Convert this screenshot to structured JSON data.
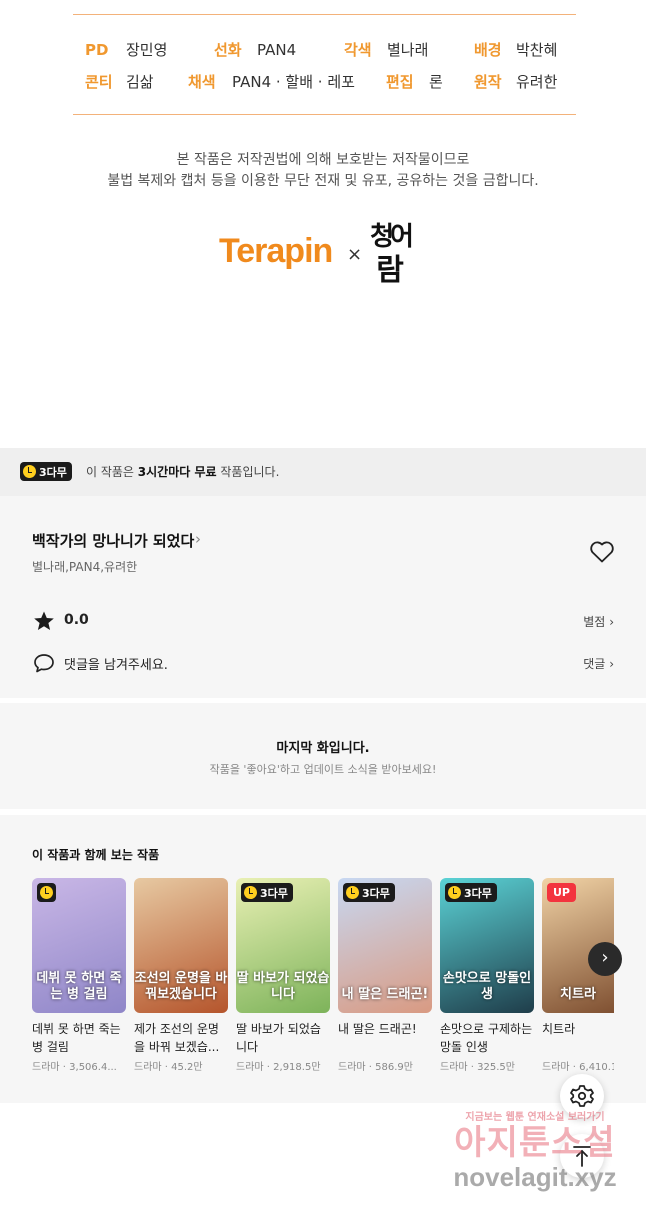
{
  "credits": [
    {
      "label": "PD",
      "value": "장민영"
    },
    {
      "label": "선화",
      "value": "PAN4"
    },
    {
      "label": "각색",
      "value": "별나래"
    },
    {
      "label": "배경",
      "value": "박찬혜"
    },
    {
      "label": "콘티",
      "value": "김삶"
    },
    {
      "label": "채색",
      "value": "PAN4 · 할배 · 레포"
    },
    {
      "label": "편집",
      "value": "론"
    },
    {
      "label": "원작",
      "value": "유려한"
    }
  ],
  "copyright": {
    "line1": "본 작품은 저작권법에 의해 보호받는 저작물이므로",
    "line2": "불법 복제와 캡처 등을 이용한 무단 전재 및 유포, 공유하는 것을 금합니다."
  },
  "logos": {
    "publisher": "Terapin",
    "separator": "×",
    "partner_line1": "청어",
    "partner_line2": "람"
  },
  "free_bar": {
    "badge": "3다무",
    "text_before": "이 작품은 ",
    "text_bold": "3시간마다 무료",
    "text_after": " 작품입니다."
  },
  "work": {
    "title": "백작가의 망나니가 되었다",
    "authors": "별나래,PAN4,유려한",
    "rating": "0.0",
    "rating_link": "별점",
    "comment_placeholder": "댓글을 남겨주세요.",
    "comment_link": "댓글"
  },
  "last_episode": {
    "title": "마지막 화입니다.",
    "subtitle": "작품을 '좋아요'하고 업데이트 소식을 받아보세요!"
  },
  "recommendations": {
    "title": "이 작품과 함께 보는 작품",
    "items": [
      {
        "title": "데뷔 못 하면 죽는 병 걸림",
        "genre": "드라마",
        "views": "3,506.4...",
        "badge": "",
        "cover_text": "데뷔 못 하면 죽는 병 걸림",
        "colors": [
          "#c9b7e6",
          "#8f86c8"
        ]
      },
      {
        "title": "제가 조선의 운명을 바꿔 보겠습...",
        "genre": "드라마",
        "views": "45.2만",
        "badge": "",
        "cover_text": "조선의 운명을 바꿔보겠습니다",
        "colors": [
          "#e7c9a2",
          "#b5552c"
        ]
      },
      {
        "title": "딸 바보가 되었습니다",
        "genre": "드라마",
        "views": "2,918.5만",
        "badge": "3다무",
        "cover_text": "딸 바보가 되었습니다",
        "colors": [
          "#e9f0b4",
          "#7db35a"
        ]
      },
      {
        "title": "내 딸은 드래곤!",
        "genre": "드라마",
        "views": "586.9만",
        "badge": "3다무",
        "cover_text": "내 딸은 드래곤!",
        "colors": [
          "#c7d8f2",
          "#d99a82"
        ]
      },
      {
        "title": "손맛으로 구제하는 망돌 인생",
        "genre": "드라마",
        "views": "325.5만",
        "badge": "3다무",
        "cover_text": "손맛으로 망돌인생",
        "colors": [
          "#5bd3d6",
          "#1f3d4a"
        ]
      },
      {
        "title": "치트라",
        "genre": "드라마",
        "views": "6,410.1",
        "badge": "UP",
        "cover_text": "치트라",
        "colors": [
          "#f1d3a6",
          "#7a4a2c"
        ]
      }
    ]
  },
  "watermark": {
    "line1": "지금보는 웹툰 연재소설 보러가기",
    "line2": "아지툰소설",
    "line3": "novelagit.xyz"
  }
}
